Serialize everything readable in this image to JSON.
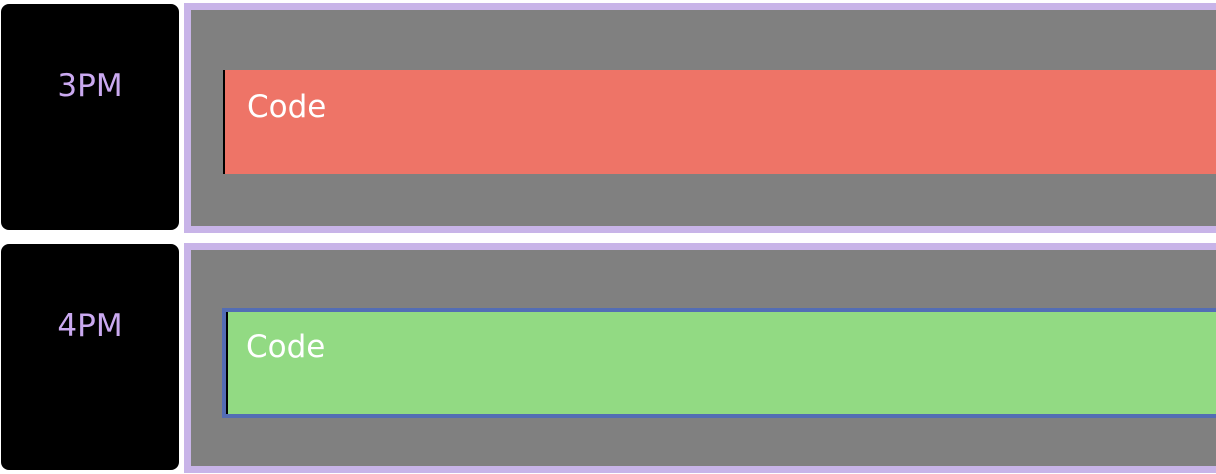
{
  "schedule": {
    "rows": [
      {
        "time_label": "3PM",
        "event": {
          "title": "Code",
          "color": "#ee7467",
          "selected": false
        }
      },
      {
        "time_label": "4PM",
        "event": {
          "title": "Code",
          "color": "#92da83",
          "selected": true
        }
      }
    ],
    "colors": {
      "time_label_background": "#000000",
      "time_label_text": "#caa9f0",
      "slot_background": "#808080",
      "slot_border": "#c8b4e8",
      "selection_outline": "#536db5",
      "event_text": "#ffffff"
    }
  }
}
